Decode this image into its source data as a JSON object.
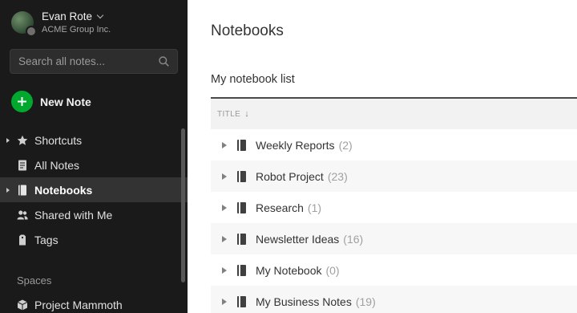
{
  "account": {
    "name": "Evan Rote",
    "organization": "ACME Group Inc."
  },
  "search": {
    "placeholder": "Search all notes..."
  },
  "new_note": {
    "label": "New Note",
    "accent": "#00a82d"
  },
  "nav": {
    "items": [
      {
        "label": "Shortcuts",
        "icon": "star-icon",
        "expandable": true,
        "active": false
      },
      {
        "label": "All Notes",
        "icon": "note-icon",
        "expandable": false,
        "active": false
      },
      {
        "label": "Notebooks",
        "icon": "notebook-icon",
        "expandable": true,
        "active": true
      },
      {
        "label": "Shared with Me",
        "icon": "people-icon",
        "expandable": false,
        "active": false
      },
      {
        "label": "Tags",
        "icon": "tag-icon",
        "expandable": false,
        "active": false
      }
    ]
  },
  "spaces": {
    "label": "Spaces",
    "items": [
      {
        "label": "Project Mammoth",
        "icon": "cube-icon"
      }
    ]
  },
  "main": {
    "title": "Notebooks",
    "list_heading": "My notebook list",
    "column_title": "TITLE",
    "sort_icon": "↓",
    "notebooks": [
      {
        "name": "Weekly Reports",
        "count": "(2)"
      },
      {
        "name": "Robot Project",
        "count": "(23)"
      },
      {
        "name": "Research",
        "count": "(1)"
      },
      {
        "name": "Newsletter Ideas",
        "count": "(16)"
      },
      {
        "name": "My Notebook",
        "count": "(0)"
      },
      {
        "name": "My Business Notes",
        "count": "(19)"
      }
    ]
  },
  "colors": {
    "sidebar_bg": "#1a1a1a",
    "active_item_bg": "#333333",
    "brand_green": "#00a82d"
  }
}
